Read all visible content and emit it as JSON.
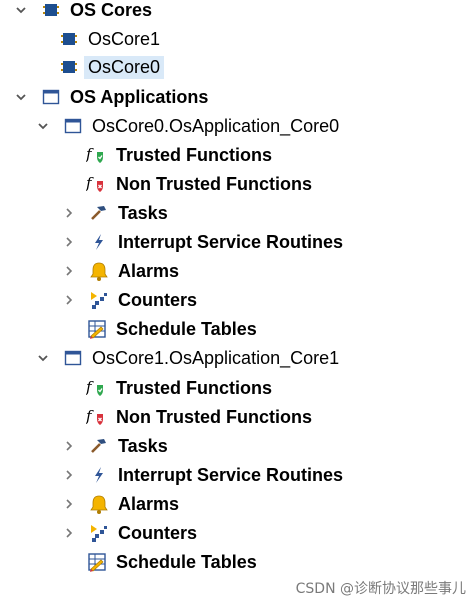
{
  "tree": {
    "os_cores": {
      "label": "OS Cores",
      "children": [
        "OsCore1",
        "OsCore0"
      ],
      "selected": "OsCore0"
    },
    "os_applications": {
      "label": "OS Applications",
      "apps": [
        {
          "label": "OsCore0.OsApplication_Core0",
          "items": {
            "trusted": "Trusted Functions",
            "non_trusted": "Non Trusted Functions",
            "tasks": "Tasks",
            "isr": "Interrupt Service Routines",
            "alarms": "Alarms",
            "counters": "Counters",
            "schedule": "Schedule Tables"
          }
        },
        {
          "label": "OsCore1.OsApplication_Core1",
          "items": {
            "trusted": "Trusted Functions",
            "non_trusted": "Non Trusted Functions",
            "tasks": "Tasks",
            "isr": "Interrupt Service Routines",
            "alarms": "Alarms",
            "counters": "Counters",
            "schedule": "Schedule Tables"
          }
        }
      ]
    }
  },
  "watermark": "CSDN @诊断协议那些事儿",
  "colors": {
    "selection": "#d9e9f8",
    "chip_blue": "#1d4e8f",
    "shield_green": "#2fa84f",
    "shield_red": "#d8323c",
    "bell_yellow": "#f4b400"
  }
}
